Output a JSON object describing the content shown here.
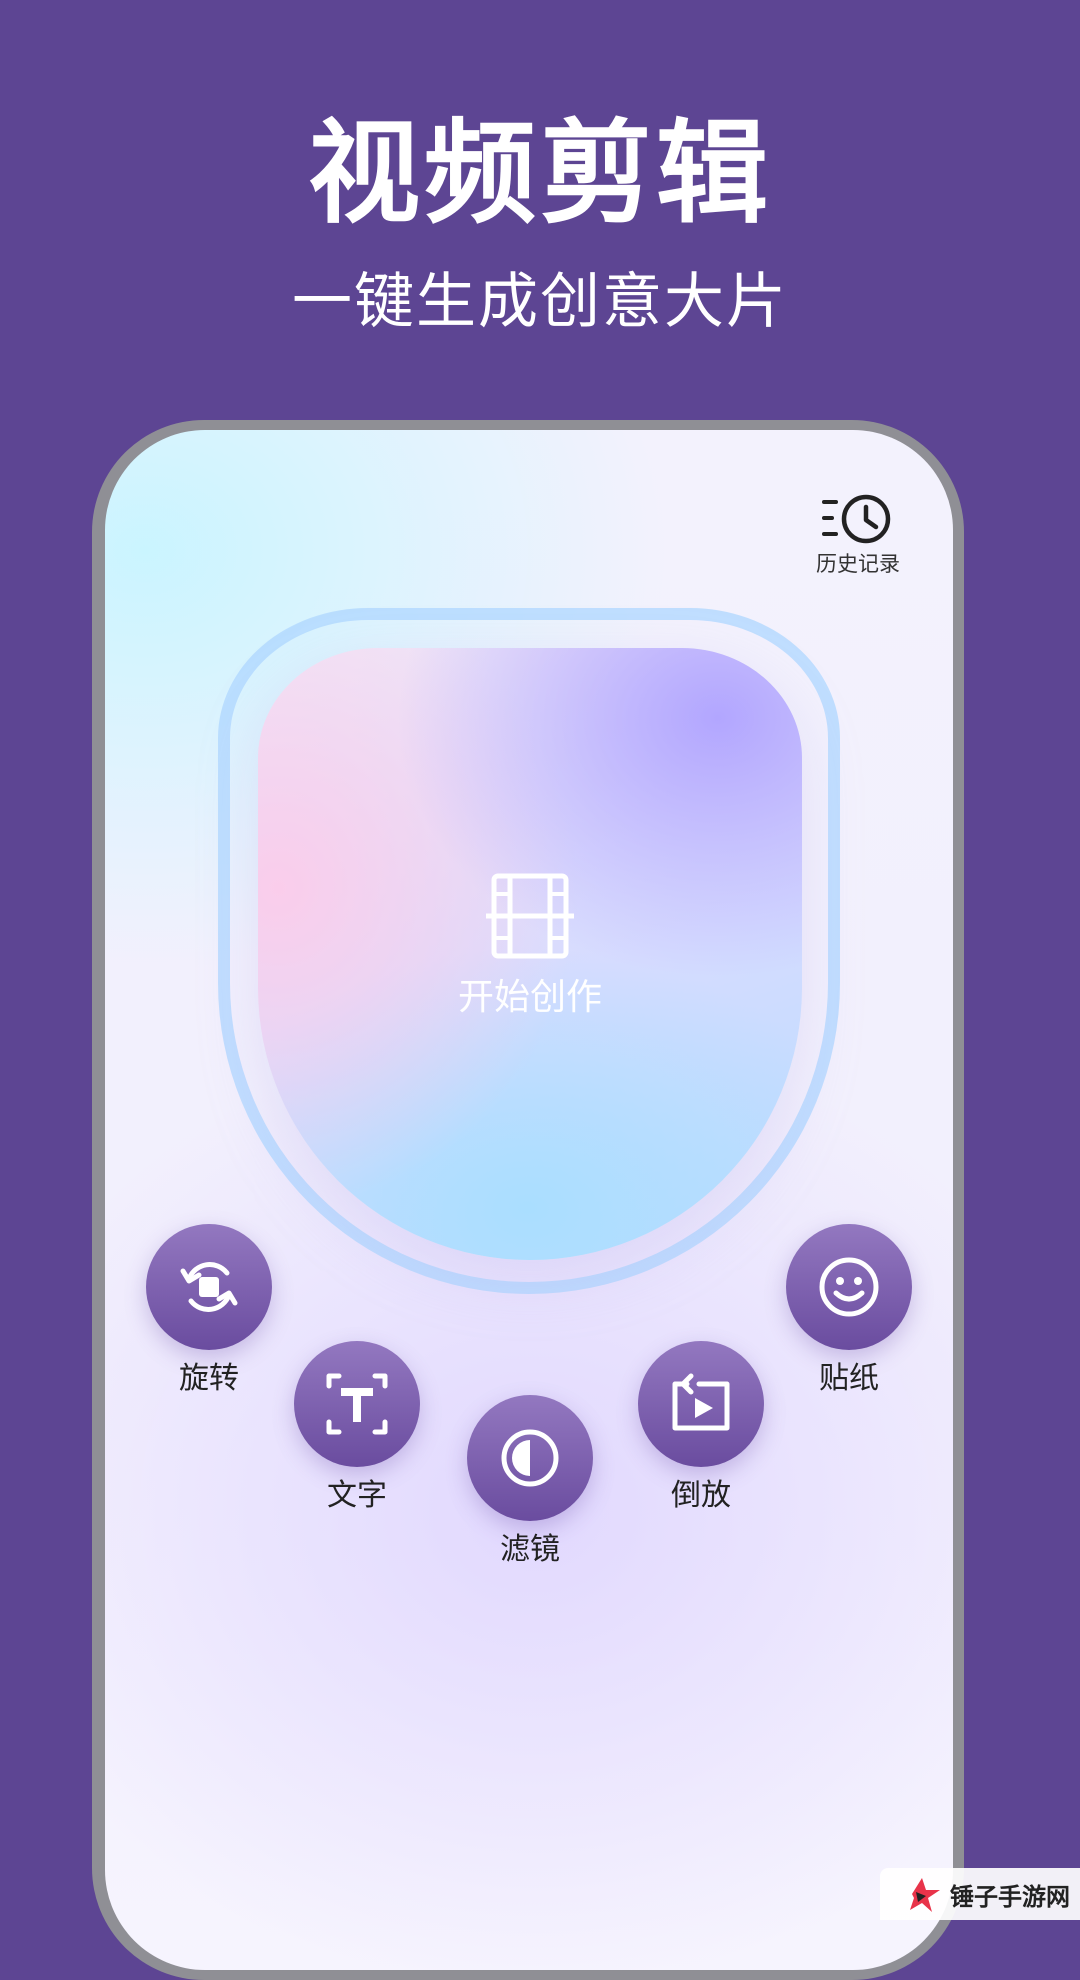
{
  "banner": {
    "title": "视频剪辑",
    "subtitle": "一键生成创意大片"
  },
  "screen": {
    "history_label": "历史记录",
    "start_label": "开始创作",
    "tools": {
      "rotate": "旋转",
      "text": "文字",
      "filter": "滤镜",
      "reverse": "倒放",
      "sticker": "贴纸"
    }
  },
  "watermark": {
    "text": "锤子手游网"
  },
  "colors": {
    "background": "#5d4593",
    "tool_circle": "#7b5fb0",
    "text_dark": "#222222",
    "white": "#ffffff"
  },
  "icons": {
    "history": "history-clock-icon",
    "start": "film-strip-icon",
    "rotate": "rotate-icon",
    "text": "text-icon",
    "filter": "filter-icon",
    "reverse": "reverse-play-icon",
    "sticker": "smiley-icon"
  }
}
